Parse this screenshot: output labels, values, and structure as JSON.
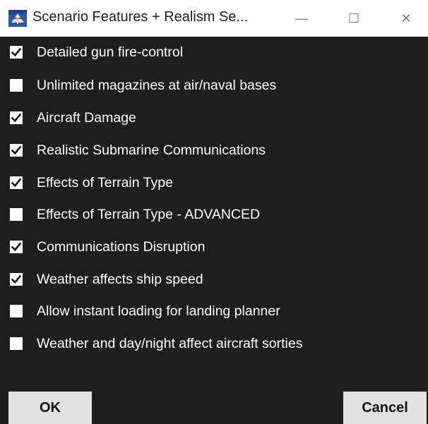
{
  "window": {
    "title": "Scenario Features + Realism Se...",
    "minimize_glyph": "—",
    "maximize_glyph": "☐",
    "close_glyph": "✕",
    "app_icon": "app-icon"
  },
  "options": [
    {
      "label": "Detailed gun fire-control",
      "checked": true
    },
    {
      "label": "Unlimited magazines at air/naval bases",
      "checked": false
    },
    {
      "label": "Aircraft Damage",
      "checked": true
    },
    {
      "label": "Realistic Submarine Communications",
      "checked": true
    },
    {
      "label": "Effects of Terrain Type",
      "checked": true
    },
    {
      "label": "Effects of Terrain Type - ADVANCED",
      "checked": false
    },
    {
      "label": "Communications Disruption",
      "checked": true
    },
    {
      "label": "Weather affects ship speed",
      "checked": true
    },
    {
      "label": "Allow instant loading for landing planner",
      "checked": false
    },
    {
      "label": "Weather and day/night affect aircraft sorties",
      "checked": false
    }
  ],
  "buttons": {
    "ok_label": "OK",
    "cancel_label": "Cancel"
  },
  "colors": {
    "background": "#1e1e1e",
    "text": "#ffffff",
    "button": "#e2e2e2"
  }
}
